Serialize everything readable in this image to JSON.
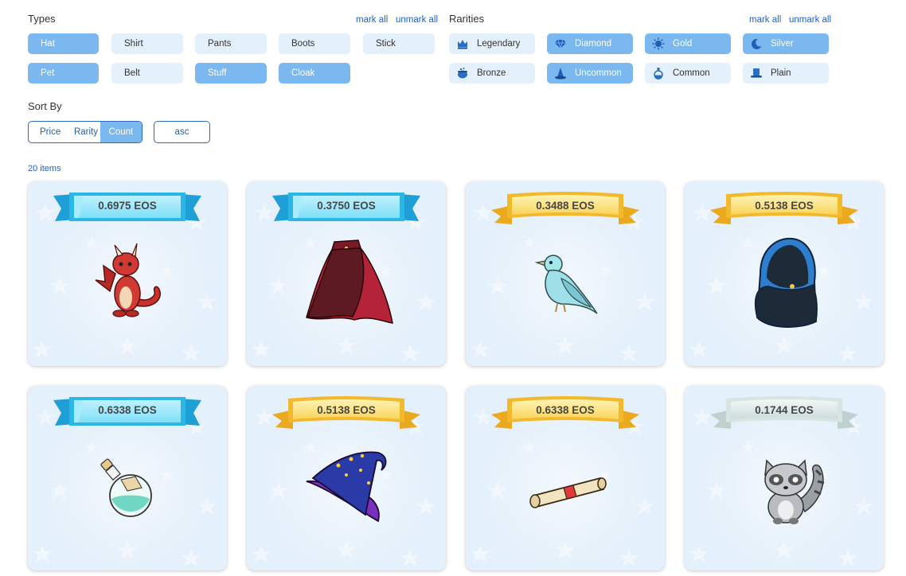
{
  "types": {
    "title": "Types",
    "mark_all": "mark all",
    "unmark_all": "unmark all",
    "chips": [
      {
        "label": "Hat",
        "selected": true
      },
      {
        "label": "Shirt",
        "selected": false
      },
      {
        "label": "Pants",
        "selected": false
      },
      {
        "label": "Boots",
        "selected": false
      },
      {
        "label": "Stick",
        "selected": false
      },
      {
        "label": "Pet",
        "selected": true
      },
      {
        "label": "Belt",
        "selected": false
      },
      {
        "label": "Stuff",
        "selected": true
      },
      {
        "label": "Cloak",
        "selected": true
      }
    ]
  },
  "rarities": {
    "title": "Rarities",
    "mark_all": "mark all",
    "unmark_all": "unmark all",
    "chips": [
      {
        "label": "Legendary",
        "icon": "crown-icon",
        "selected": false
      },
      {
        "label": "Diamond",
        "icon": "diamond-icon",
        "selected": true
      },
      {
        "label": "Gold",
        "icon": "sun-icon",
        "selected": true
      },
      {
        "label": "Silver",
        "icon": "moon-icon",
        "selected": true
      },
      {
        "label": "Bronze",
        "icon": "cauldron-icon",
        "selected": false
      },
      {
        "label": "Uncommon",
        "icon": "wizard-hat-icon",
        "selected": true
      },
      {
        "label": "Common",
        "icon": "potion-icon",
        "selected": false
      },
      {
        "label": "Plain",
        "icon": "top-hat-icon",
        "selected": false
      }
    ]
  },
  "sort": {
    "title": "Sort By",
    "options": [
      {
        "label": "Price",
        "active": false
      },
      {
        "label": "Rarity",
        "active": false
      },
      {
        "label": "Count",
        "active": true
      }
    ],
    "order": "asc"
  },
  "items_count": "20 items",
  "colors": {
    "accent": "#1e63c5",
    "chip_bg": "#e4f0fb",
    "chip_selected": "#7ab8ef",
    "card_bg": "#e4f0fb",
    "banner_diamond": "#3fc0e8",
    "banner_gold": "#f6c744",
    "banner_silver": "#c9dcdc"
  },
  "cards": [
    {
      "price": "0.6975 EOS",
      "banner": "diamond",
      "item": "dragon-pet"
    },
    {
      "price": "0.3750 EOS",
      "banner": "diamond",
      "item": "red-cloak"
    },
    {
      "price": "0.3488 EOS",
      "banner": "gold",
      "item": "bird-pet"
    },
    {
      "price": "0.5138 EOS",
      "banner": "gold",
      "item": "blue-hooded-cloak"
    },
    {
      "price": "0.6338 EOS",
      "banner": "diamond",
      "item": "potion-stuff"
    },
    {
      "price": "0.5138 EOS",
      "banner": "gold",
      "item": "wizard-hat"
    },
    {
      "price": "0.6338 EOS",
      "banner": "gold",
      "item": "scroll-stuff"
    },
    {
      "price": "0.1744 EOS",
      "banner": "silver",
      "item": "raccoon-pet"
    }
  ]
}
